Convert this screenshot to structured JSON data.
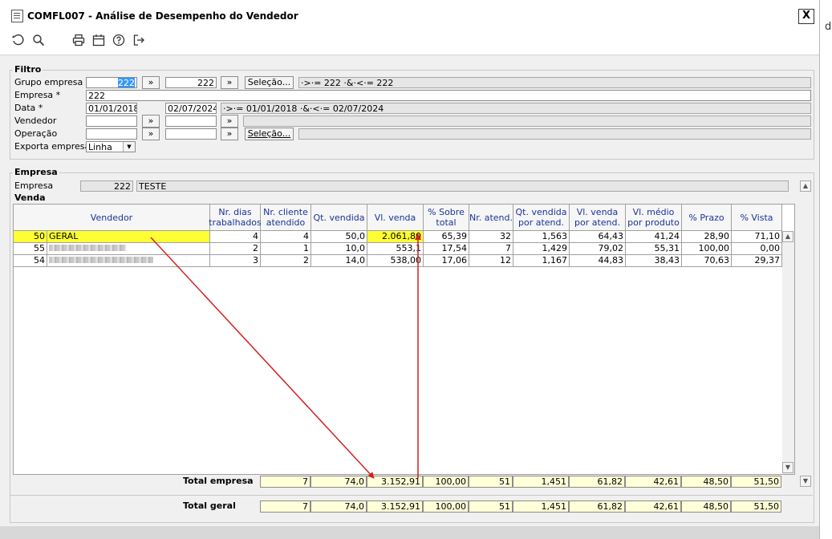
{
  "window": {
    "title": "COMFL007 - Análise de Desempenho do Vendedor",
    "close_label": "X"
  },
  "toolbar": {
    "icons": [
      "refresh-icon",
      "search-icon",
      "print-icon",
      "calendar-icon",
      "help-icon",
      "exit-icon"
    ]
  },
  "side_text": "d",
  "filtro": {
    "title": "Filtro",
    "grupo_empresa": {
      "label": "Grupo empresa",
      "from": "222",
      "to": "222",
      "selecao_label": "Seleção...",
      "expr": "·>·= 222 ·&·<·= 222"
    },
    "empresa": {
      "label": "Empresa *",
      "value": "222"
    },
    "data": {
      "label": "Data *",
      "from": "01/01/2018",
      "to": "02/07/2024",
      "expr": "·>·= 01/01/2018 ·&·<·= 02/07/2024"
    },
    "vendedor": {
      "label": "Vendedor",
      "from": "",
      "to": ""
    },
    "operacao": {
      "label": "Operação",
      "from": "",
      "to": "",
      "selecao_label": "Seleção..."
    },
    "exporta_empresa": {
      "label": "Exporta empresa",
      "value": "Linha"
    },
    "range_button": "»"
  },
  "empresa_section": {
    "title": "Empresa",
    "label": "Empresa",
    "code": "222",
    "name": "TESTE"
  },
  "venda_section": {
    "title": "Venda"
  },
  "table": {
    "columns": [
      "Vendedor",
      "Nr. dias\ntrabalhados",
      "Nr. cliente\natendido",
      "Qt. vendida",
      "Vl. venda",
      "% Sobre\ntotal",
      "Nr. atend.",
      "Qt. vendida\npor atend.",
      "Vl. venda\npor  atend.",
      "Vl.  médio\npor  produto",
      "% Prazo",
      "% Vista"
    ],
    "rows": [
      {
        "code": "50",
        "name": "GERAL",
        "cells": [
          "4",
          "4",
          "50,0",
          "2.061,80",
          "65,39",
          "32",
          "1,563",
          "64,43",
          "41,24",
          "28,90",
          "71,10"
        ]
      },
      {
        "code": "55",
        "name": "",
        "cells": [
          "2",
          "1",
          "10,0",
          "553,1",
          "17,54",
          "7",
          "1,429",
          "79,02",
          "55,31",
          "100,00",
          "0,00"
        ]
      },
      {
        "code": "54",
        "name": "",
        "cells": [
          "3",
          "2",
          "14,0",
          "538,00",
          "17,06",
          "12",
          "1,167",
          "44,83",
          "38,43",
          "70,63",
          "29,37"
        ]
      }
    ]
  },
  "totals": {
    "empresa": {
      "label": "Total empresa",
      "cells": [
        "7",
        "74,0",
        "3.152,91",
        "100,00",
        "51",
        "1,451",
        "61,82",
        "42,61",
        "48,50",
        "51,50"
      ]
    },
    "geral": {
      "label": "Total geral",
      "cells": [
        "7",
        "74,0",
        "3.152,91",
        "100,00",
        "51",
        "1,451",
        "61,82",
        "42,61",
        "48,50",
        "51,50"
      ]
    }
  },
  "colors": {
    "highlight": "#ffff33",
    "annotation_arrow": "#d42020",
    "header_text": "#1a3399",
    "selection": "#3399ff"
  }
}
